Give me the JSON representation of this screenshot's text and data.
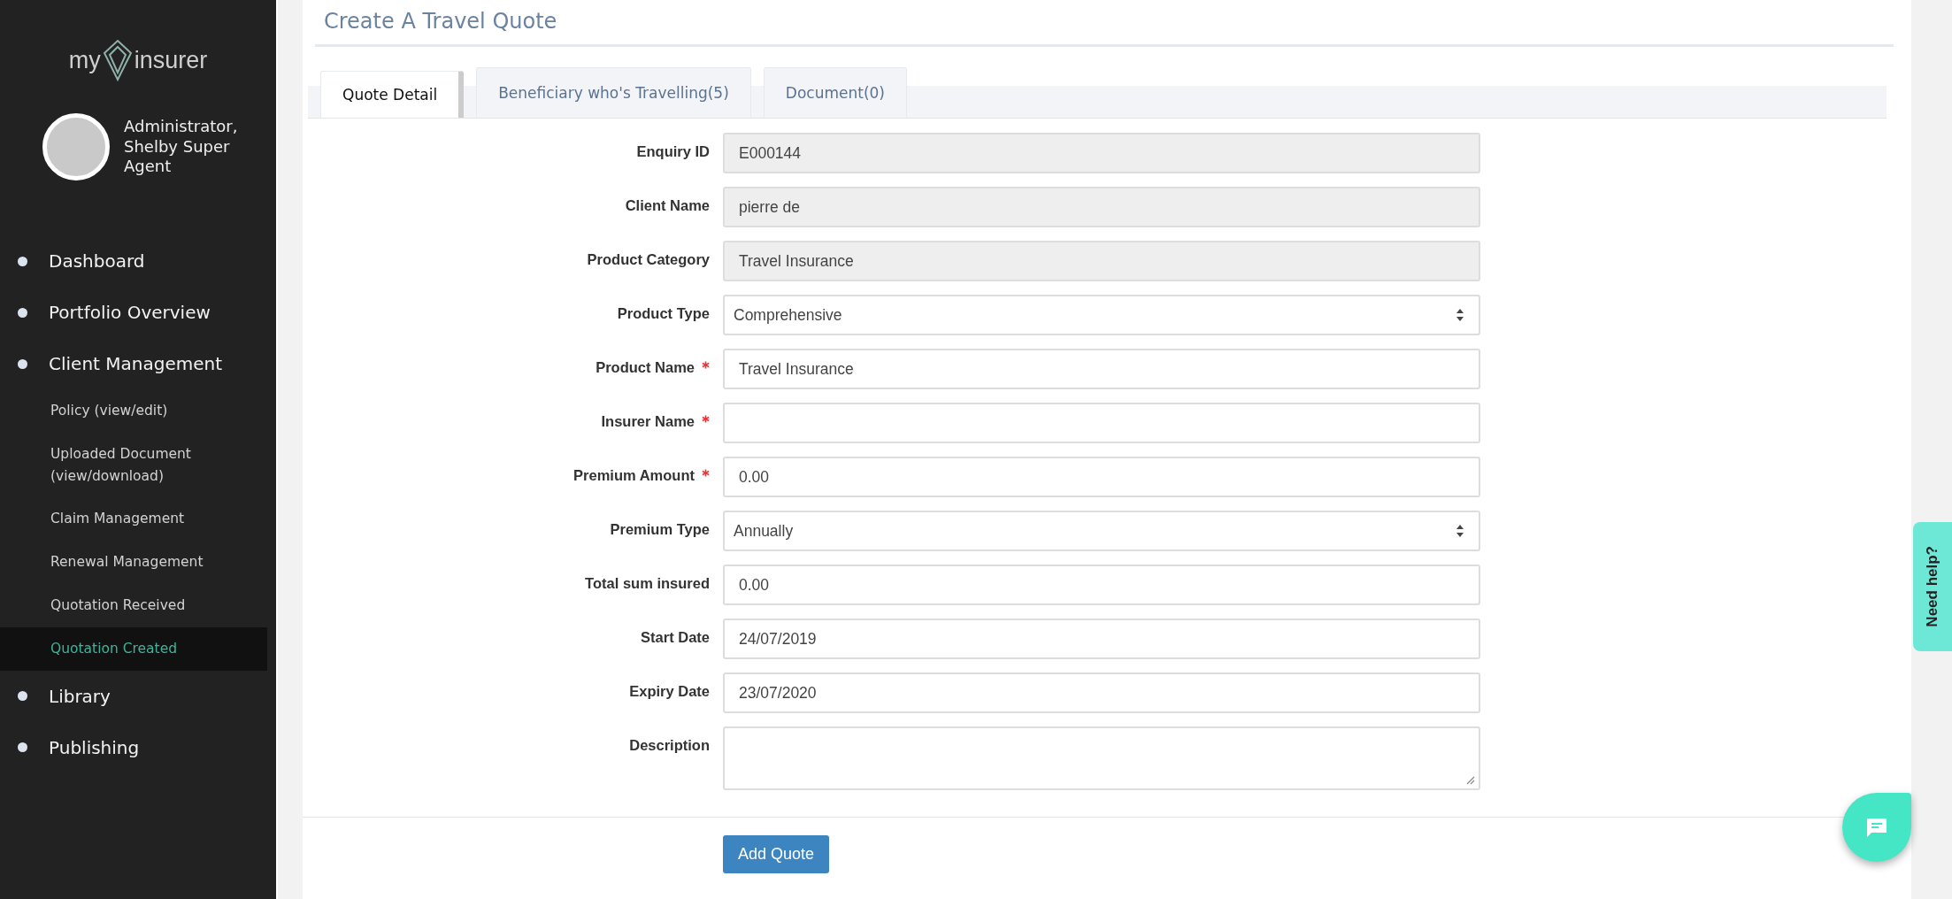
{
  "sidebar": {
    "logo": {
      "left": "my",
      "right": "insurer"
    },
    "user": {
      "name": "Administrator, Shelby Super Agent"
    },
    "items": [
      {
        "label": "Dashboard",
        "selected": false
      },
      {
        "label": "Portfolio Overview",
        "selected": false
      },
      {
        "label": "Client Management",
        "selected": false,
        "children": [
          {
            "label": "Policy (view/edit)",
            "selected": false
          },
          {
            "label": "Uploaded Document (view/download)",
            "selected": false
          },
          {
            "label": "Claim Management",
            "selected": false
          },
          {
            "label": "Renewal Management",
            "selected": false
          },
          {
            "label": "Quotation Received",
            "selected": false
          },
          {
            "label": "Quotation Created",
            "selected": true
          }
        ]
      },
      {
        "label": "Library",
        "selected": false
      },
      {
        "label": "Publishing",
        "selected": false
      }
    ]
  },
  "page": {
    "title": "Create A Travel Quote"
  },
  "tabs": [
    {
      "label": "Quote Detail",
      "selected": true
    },
    {
      "label": "Beneficiary who's Travelling(5)",
      "selected": false
    },
    {
      "label": "Document(0)",
      "selected": false
    }
  ],
  "fields": [
    {
      "label": "Enquiry ID",
      "kind": "readonly",
      "required": false,
      "value": "E000144"
    },
    {
      "label": "Client Name",
      "kind": "readonly",
      "required": false,
      "value": "pierre de"
    },
    {
      "label": "Product Category",
      "kind": "readonly",
      "required": false,
      "value": "Travel Insurance"
    },
    {
      "label": "Product Type",
      "kind": "select",
      "required": false,
      "value": "Comprehensive"
    },
    {
      "label": "Product Name",
      "kind": "input",
      "required": true,
      "value": "Travel Insurance"
    },
    {
      "label": "Insurer Name",
      "kind": "input",
      "required": true
    },
    {
      "label": "Premium Amount",
      "kind": "input",
      "required": true,
      "value": "0.00"
    },
    {
      "label": "Premium Type",
      "kind": "select",
      "required": false,
      "value": "Annually"
    },
    {
      "label": "Total sum insured",
      "kind": "input",
      "required": false,
      "value": "0.00"
    },
    {
      "label": "Start Date",
      "kind": "input",
      "required": false,
      "value": "24/07/2019"
    },
    {
      "label": "Expiry Date",
      "kind": "input",
      "required": false,
      "value": "23/07/2020"
    },
    {
      "label": "Description",
      "kind": "textarea",
      "required": false
    }
  ],
  "submit": "Add Quote",
  "help_tab": "Need help?"
}
